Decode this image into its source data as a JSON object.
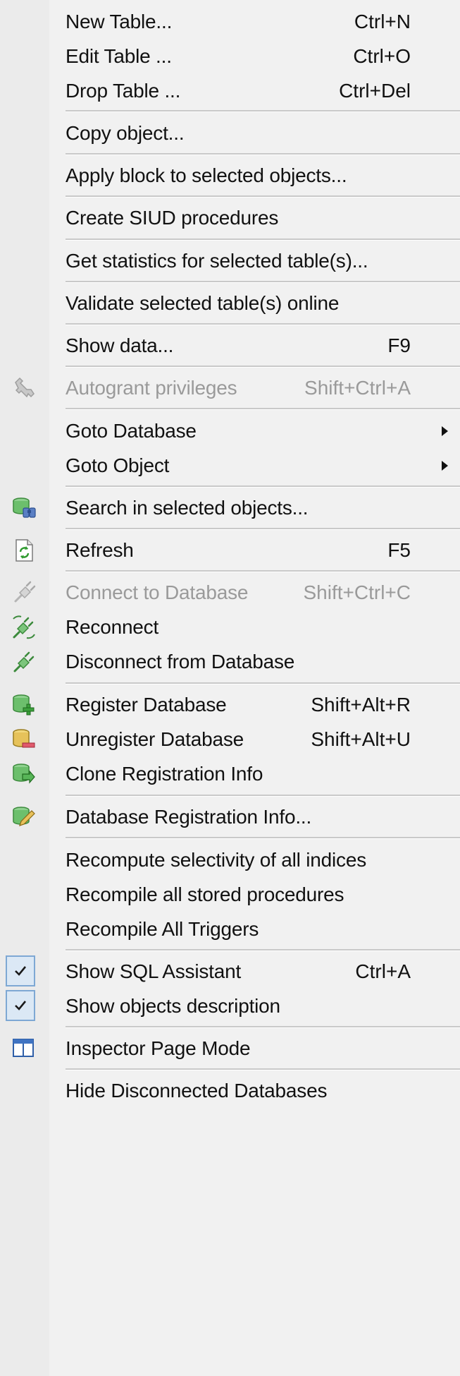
{
  "menu": {
    "items": [
      {
        "id": "new_table",
        "label": "New Table...",
        "shortcut": "Ctrl+N"
      },
      {
        "id": "edit_table",
        "label": "Edit Table ...",
        "shortcut": "Ctrl+O"
      },
      {
        "id": "drop_table",
        "label": "Drop Table ...",
        "shortcut": "Ctrl+Del"
      },
      {
        "id": "copy_object",
        "label": "Copy object..."
      },
      {
        "id": "apply_block",
        "label": "Apply block to selected objects..."
      },
      {
        "id": "create_siud",
        "label": "Create SIUD procedures"
      },
      {
        "id": "get_statistics",
        "label": "Get statistics for selected table(s)..."
      },
      {
        "id": "validate_tables",
        "label": "Validate selected table(s) online"
      },
      {
        "id": "show_data",
        "label": "Show data...",
        "shortcut": "F9"
      },
      {
        "id": "autogrant",
        "label": "Autogrant privileges",
        "shortcut": "Shift+Ctrl+A",
        "disabled": true,
        "icon": "wrench-icon"
      },
      {
        "id": "goto_database",
        "label": "Goto Database",
        "submenu": true
      },
      {
        "id": "goto_object",
        "label": "Goto Object",
        "submenu": true
      },
      {
        "id": "search_objects",
        "label": "Search in selected objects...",
        "icon": "database-search-icon"
      },
      {
        "id": "refresh",
        "label": "Refresh",
        "shortcut": "F5",
        "icon": "refresh-icon"
      },
      {
        "id": "connect",
        "label": "Connect to Database",
        "shortcut": "Shift+Ctrl+C",
        "disabled": true,
        "icon": "plug-icon"
      },
      {
        "id": "reconnect",
        "label": "Reconnect",
        "icon": "reconnect-icon"
      },
      {
        "id": "disconnect",
        "label": "Disconnect from Database",
        "icon": "unplug-icon"
      },
      {
        "id": "register_db",
        "label": "Register Database",
        "shortcut": "Shift+Alt+R",
        "icon": "database-add-icon"
      },
      {
        "id": "unregister_db",
        "label": "Unregister Database",
        "shortcut": "Shift+Alt+U",
        "icon": "database-remove-icon"
      },
      {
        "id": "clone_registration",
        "label": "Clone Registration Info",
        "icon": "database-clone-icon"
      },
      {
        "id": "registration_info",
        "label": "Database Registration Info...",
        "icon": "database-edit-icon"
      },
      {
        "id": "recompute_selectivity",
        "label": "Recompute selectivity of all indices"
      },
      {
        "id": "recompile_procedures",
        "label": "Recompile all stored procedures"
      },
      {
        "id": "recompile_triggers",
        "label": "Recompile All Triggers"
      },
      {
        "id": "show_sql_assistant",
        "label": "Show SQL Assistant",
        "shortcut": "Ctrl+A",
        "checked": true
      },
      {
        "id": "show_description",
        "label": "Show objects description",
        "checked": true
      },
      {
        "id": "inspector_page_mode",
        "label": "Inspector Page Mode",
        "icon": "panel-icon"
      },
      {
        "id": "hide_disconnected",
        "label": "Hide Disconnected Databases"
      }
    ]
  }
}
